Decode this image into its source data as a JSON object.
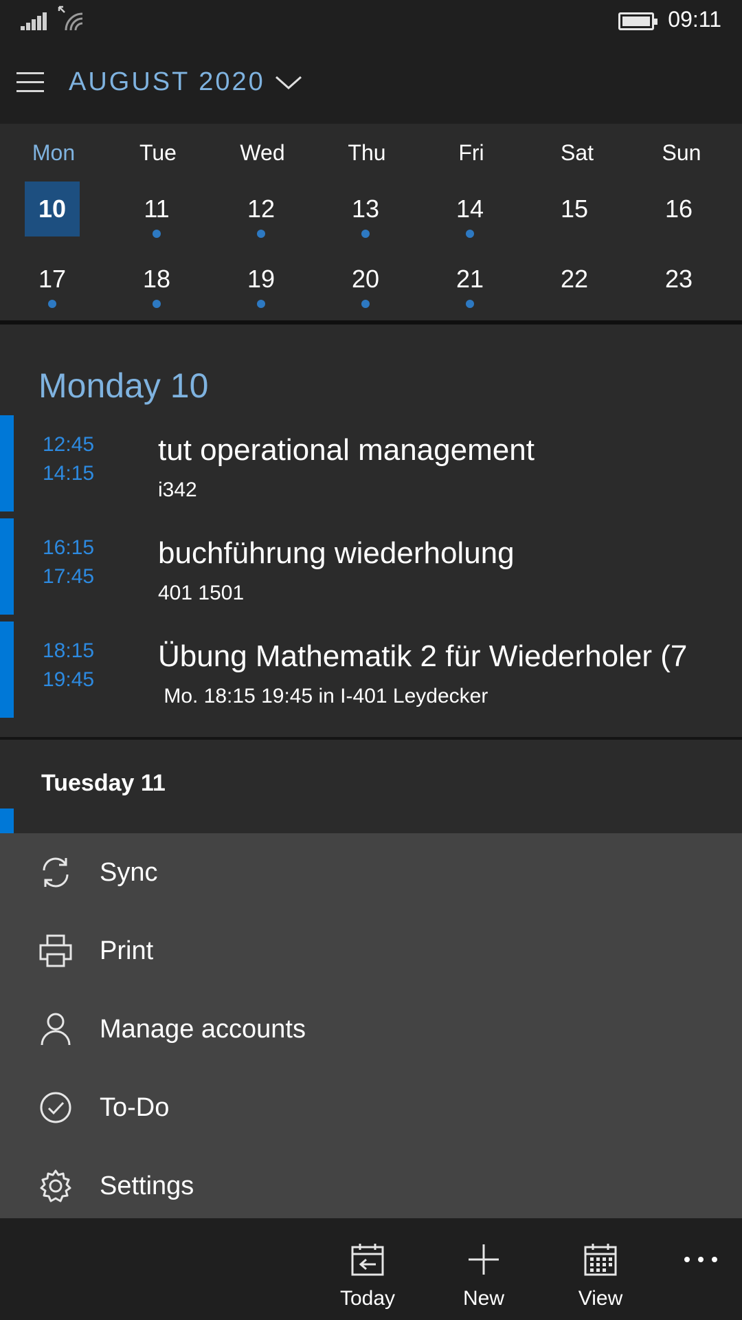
{
  "status_bar": {
    "time": "09:11"
  },
  "header": {
    "month_title": "AUGUST 2020"
  },
  "week": {
    "days_of_week": [
      "Mon",
      "Tue",
      "Wed",
      "Thu",
      "Fri",
      "Sat",
      "Sun"
    ],
    "rows": [
      [
        "10",
        "11",
        "12",
        "13",
        "14",
        "15",
        "16"
      ],
      [
        "17",
        "18",
        "19",
        "20",
        "21",
        "22",
        "23"
      ]
    ],
    "selected_day": "10"
  },
  "agenda": {
    "day1_heading": "Monday 10",
    "events": [
      {
        "start": "12:45",
        "end": "14:15",
        "title": "tut operational management",
        "location": "i342"
      },
      {
        "start": "16:15",
        "end": "17:45",
        "title": "buchführung wiederholung",
        "location": "401 1501"
      },
      {
        "start": "18:15",
        "end": "19:45",
        "title": "Übung Mathematik 2 für Wiederholer (7",
        "location": " Mo. 18:15 19:45 in I-401 Leydecker"
      }
    ],
    "day2_heading": "Tuesday 11"
  },
  "menu": {
    "items": [
      {
        "label": "Sync",
        "icon": "sync-icon"
      },
      {
        "label": "Print",
        "icon": "printer-icon"
      },
      {
        "label": "Manage accounts",
        "icon": "person-icon"
      },
      {
        "label": "To-Do",
        "icon": "checkmark-circle-icon"
      },
      {
        "label": "Settings",
        "icon": "gear-icon"
      }
    ]
  },
  "bottom_bar": {
    "today_label": "Today",
    "new_label": "New",
    "view_label": "View"
  },
  "colors": {
    "accent": "#0078d7",
    "accent_light": "#7fb3e0",
    "selected_day_bg": "#1d4f80",
    "menu_bg": "#444444"
  }
}
